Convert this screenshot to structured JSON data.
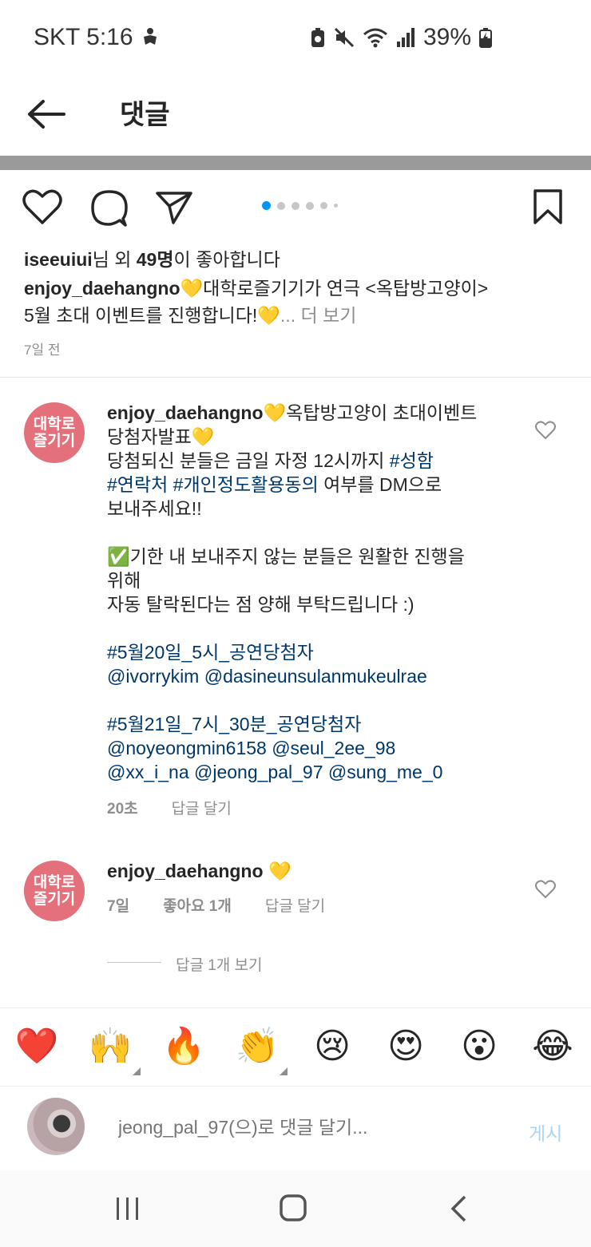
{
  "status_bar": {
    "carrier_time": "SKT 5:16",
    "battery": "39%",
    "icons": [
      "accessibility-icon",
      "battery-saver-icon",
      "mute-icon",
      "wifi-icon",
      "signal-icon",
      "charging-battery-icon"
    ]
  },
  "header": {
    "title": "댓글"
  },
  "post": {
    "carousel_pages": 6,
    "carousel_active": 1,
    "likes_user": "iseeuiui",
    "likes_mid": "님 외 ",
    "likes_count": "49명",
    "likes_suffix": "이 좋아합니다",
    "caption_user": "enjoy_daehangno",
    "caption_line1": "💛대학로즐기기가 연극 <옥탑방고양이>",
    "caption_line2": "5월 초대 이벤트를 진행합니다!💛",
    "caption_more": "... 더 보기",
    "time_ago": "7일 전"
  },
  "comments": [
    {
      "avatar_line1": "대학로",
      "avatar_line2": "즐기기",
      "user": "enjoy_daehangno",
      "line1": "💛옥탑방고양이 초대이벤트",
      "line2": "당첨자발표💛",
      "line3_a": "당첨되신 분들은 금일 자정 12시까지 ",
      "line3_tag": "#성함",
      "line4_tag1": "#연락처",
      "line4_tag2": "#개인정도활용동의",
      "line4_b": " 여부를 DM으로",
      "line5": "보내주세요!!",
      "line6": "✅기한 내 보내주지 않는 분들은 원활한 진행을",
      "line7": "위해",
      "line8": "자동 탈락된다는 점 양해 부탁드립니다 :)",
      "tag_a": "#5월20일_5시_공연당첨자",
      "mentions_a": "@ivorrykim @dasineunsulanmukeulrae",
      "tag_b": "#5월21일_7시_30분_공연당첨자",
      "mentions_b1": "@noyeongmin6158 @seul_2ee_98",
      "mentions_b2": "@xx_i_na @jeong_pal_97 @sung_me_0",
      "time": "20초",
      "reply": "답글 달기"
    },
    {
      "avatar_line1": "대학로",
      "avatar_line2": "즐기기",
      "user": "enjoy_daehangno",
      "text": "💛",
      "time": "7일",
      "likes": "좋아요 1개",
      "reply": "답글 달기",
      "view_replies": "답글 1개 보기"
    }
  ],
  "emoji_bar": [
    "❤️",
    "🙌",
    "🔥",
    "👏",
    "😢",
    "😍",
    "😮",
    "😂"
  ],
  "comment_input": {
    "placeholder": "jeong_pal_97(으)로 댓글 달기...",
    "post_label": "게시"
  },
  "colors": {
    "hashtag": "#00376b",
    "avatar_brand": "#e3707a",
    "post_disabled": "#a9d4f5",
    "carousel_active": "#0095f6"
  }
}
